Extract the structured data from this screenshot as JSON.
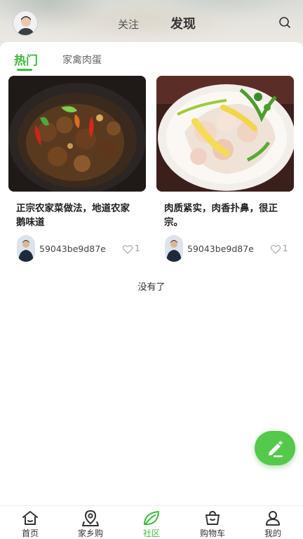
{
  "header": {
    "tabs": [
      {
        "label": "关注",
        "active": false
      },
      {
        "label": "发现",
        "active": true
      }
    ],
    "search_icon": "search-icon",
    "avatar_icon": "user-avatar"
  },
  "categories": [
    {
      "label": "热门",
      "active": true
    },
    {
      "label": "家禽肉蛋",
      "active": false
    }
  ],
  "posts": [
    {
      "title": "正宗农家菜做法，地道农家鹅味道",
      "author": "59043be9d87e",
      "likes": "1"
    },
    {
      "title": "肉质紧实，肉香扑鼻，很正宗。",
      "author": "59043be9d87e",
      "likes": "1"
    }
  ],
  "footer_note": "没有了",
  "fab": {
    "icon": "edit-pen-icon"
  },
  "tabbar": [
    {
      "label": "首页",
      "icon": "home-icon",
      "active": false
    },
    {
      "label": "家乡购",
      "icon": "location-icon",
      "active": false
    },
    {
      "label": "社区",
      "icon": "leaf-icon",
      "active": true
    },
    {
      "label": "购物车",
      "icon": "basket-icon",
      "active": false
    },
    {
      "label": "我的",
      "icon": "user-icon",
      "active": false
    }
  ],
  "colors": {
    "accent": "#3dbb3d",
    "fab": "#54c94a"
  }
}
